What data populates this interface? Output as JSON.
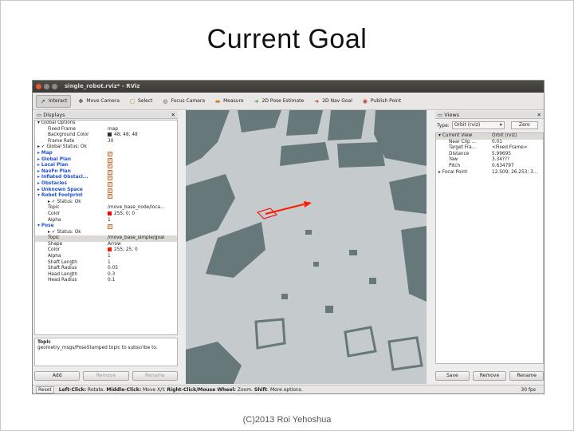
{
  "slide": {
    "title": "Current Goal",
    "footer": "(C)2013 Roi Yehoshua"
  },
  "window": {
    "title": "single_robot.rviz* - RViz"
  },
  "toolbar": [
    {
      "label": "Interact",
      "icon": "interact-icon",
      "active": true
    },
    {
      "label": "Move Camera",
      "icon": "move-camera-icon",
      "active": false
    },
    {
      "label": "Select",
      "icon": "select-icon",
      "active": false
    },
    {
      "label": "Focus Camera",
      "icon": "focus-camera-icon",
      "active": false
    },
    {
      "label": "Measure",
      "icon": "measure-icon",
      "active": false
    },
    {
      "label": "2D Pose Estimate",
      "icon": "pose-estimate-icon",
      "active": false
    },
    {
      "label": "2D Nav Goal",
      "icon": "nav-goal-icon",
      "active": false
    },
    {
      "label": "Publish Point",
      "icon": "publish-point-icon",
      "active": false
    }
  ],
  "displays": {
    "header": "Displays",
    "rows": [
      {
        "indent": 0,
        "key": "▾ Global Options",
        "value": "",
        "style": "plain"
      },
      {
        "indent": 1,
        "key": "Fixed Frame",
        "value": "map"
      },
      {
        "indent": 1,
        "key": "Background Color",
        "value": "48; 48; 48",
        "swatch": "#303030"
      },
      {
        "indent": 1,
        "key": "Frame Rate",
        "value": "30"
      },
      {
        "indent": 0,
        "key": "▸ ✓ Global Status: Ok",
        "value": ""
      },
      {
        "indent": 0,
        "key": "▸ Map",
        "value": "",
        "plugin": true,
        "check": true
      },
      {
        "indent": 0,
        "key": "▸ Global Plan",
        "value": "",
        "plugin": true,
        "check": true
      },
      {
        "indent": 0,
        "key": "▸ Local Plan",
        "value": "",
        "plugin": true,
        "check": true
      },
      {
        "indent": 0,
        "key": "▸ NavFn Plan",
        "value": "",
        "plugin": true,
        "check": true
      },
      {
        "indent": 0,
        "key": "▸ Inflated Obstacl...",
        "value": "",
        "plugin": true,
        "check": true
      },
      {
        "indent": 0,
        "key": "▸ Obstacles",
        "value": "",
        "plugin": true,
        "check": true
      },
      {
        "indent": 0,
        "key": "▸ Unknown Space",
        "value": "",
        "plugin": true,
        "check": true
      },
      {
        "indent": 0,
        "key": "▾ Robot Footprint",
        "value": "",
        "plugin": true,
        "check": true
      },
      {
        "indent": 1,
        "key": "▸ ✓ Status: Ok",
        "value": ""
      },
      {
        "indent": 1,
        "key": "Topic",
        "value": "/move_base_node/loca..."
      },
      {
        "indent": 1,
        "key": "Color",
        "value": "255; 0; 0",
        "swatch": "#ff0000"
      },
      {
        "indent": 1,
        "key": "Alpha",
        "value": "1"
      },
      {
        "indent": 0,
        "key": "▾ Pose",
        "value": "",
        "plugin": true,
        "check": true
      },
      {
        "indent": 1,
        "key": "▸ ✓ Status: Ok",
        "value": ""
      },
      {
        "indent": 1,
        "key": "Topic",
        "value": "/move_base_simple/goal",
        "selected": true
      },
      {
        "indent": 1,
        "key": "Shape",
        "value": "Arrow"
      },
      {
        "indent": 1,
        "key": "Color",
        "value": "255; 25; 0",
        "swatch": "#ff1900"
      },
      {
        "indent": 1,
        "key": "Alpha",
        "value": "1"
      },
      {
        "indent": 1,
        "key": "Shaft Length",
        "value": "1"
      },
      {
        "indent": 1,
        "key": "Shaft Radius",
        "value": "0.05"
      },
      {
        "indent": 1,
        "key": "Head Length",
        "value": "0.3"
      },
      {
        "indent": 1,
        "key": "Head Radius",
        "value": "0.1"
      }
    ],
    "description_title": "Topic",
    "description_text": "geometry_msgs/PoseStamped topic to subscribe to.",
    "buttons": [
      "Add",
      "Remove",
      "Rename"
    ]
  },
  "views": {
    "header": "Views",
    "type_label": "Type:",
    "type_value": "Orbit (rviz)",
    "zero_label": "Zero",
    "rows": [
      {
        "key": "▾ Current View",
        "value": "Orbit (rviz)",
        "selected": true
      },
      {
        "key": "Near Clip ...",
        "value": "0.01"
      },
      {
        "key": "Target Fra...",
        "value": "<Fixed Frame>"
      },
      {
        "key": "Distance",
        "value": "5.99695"
      },
      {
        "key": "Yaw",
        "value": "3.34???"
      },
      {
        "key": "Pitch",
        "value": "0.634797"
      },
      {
        "key": "▸ Focal Point",
        "value": "12.509; 26.253; 3..."
      }
    ],
    "buttons": [
      "Save",
      "Remove",
      "Rename"
    ]
  },
  "statusbar": {
    "reset_label": "Reset",
    "hint_left_bold": "Left-Click:",
    "hint_left": " Rotate. ",
    "hint_mid_bold": "Middle-Click:",
    "hint_mid": " Move X/Y. ",
    "hint_right_bold": "Right-Click/Mouse Wheel:",
    "hint_right": " Zoom. ",
    "hint_shift_bold": "Shift",
    "hint_shift": ": More options.",
    "fps": "30 fps"
  },
  "colors": {
    "map_free": "#c9cfd0",
    "map_obstacle": "#66787a",
    "goal_arrow": "#ff1900",
    "footprint": "#ff0000"
  }
}
